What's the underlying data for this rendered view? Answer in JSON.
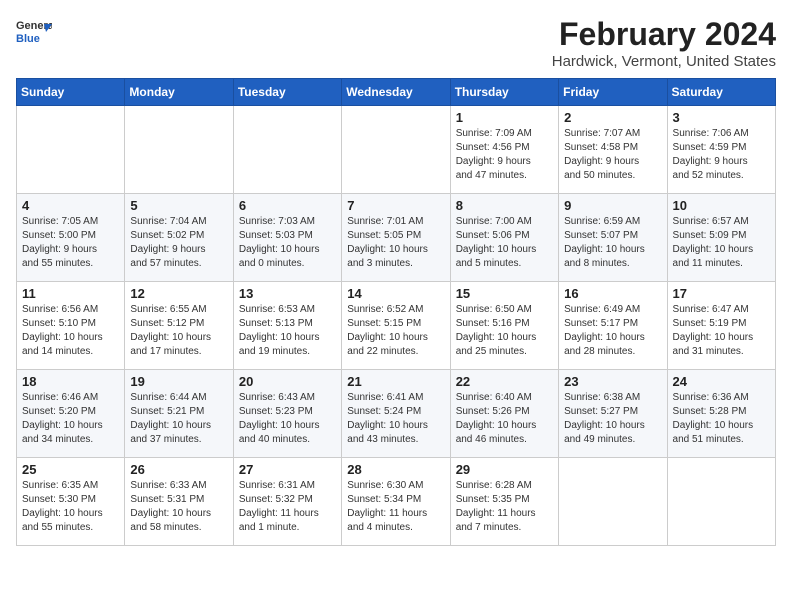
{
  "header": {
    "logo_line1": "General",
    "logo_line2": "Blue",
    "title": "February 2024",
    "subtitle": "Hardwick, Vermont, United States"
  },
  "days_of_week": [
    "Sunday",
    "Monday",
    "Tuesday",
    "Wednesday",
    "Thursday",
    "Friday",
    "Saturday"
  ],
  "weeks": [
    [
      {
        "day": "",
        "info": ""
      },
      {
        "day": "",
        "info": ""
      },
      {
        "day": "",
        "info": ""
      },
      {
        "day": "",
        "info": ""
      },
      {
        "day": "1",
        "info": "Sunrise: 7:09 AM\nSunset: 4:56 PM\nDaylight: 9 hours\nand 47 minutes."
      },
      {
        "day": "2",
        "info": "Sunrise: 7:07 AM\nSunset: 4:58 PM\nDaylight: 9 hours\nand 50 minutes."
      },
      {
        "day": "3",
        "info": "Sunrise: 7:06 AM\nSunset: 4:59 PM\nDaylight: 9 hours\nand 52 minutes."
      }
    ],
    [
      {
        "day": "4",
        "info": "Sunrise: 7:05 AM\nSunset: 5:00 PM\nDaylight: 9 hours\nand 55 minutes."
      },
      {
        "day": "5",
        "info": "Sunrise: 7:04 AM\nSunset: 5:02 PM\nDaylight: 9 hours\nand 57 minutes."
      },
      {
        "day": "6",
        "info": "Sunrise: 7:03 AM\nSunset: 5:03 PM\nDaylight: 10 hours\nand 0 minutes."
      },
      {
        "day": "7",
        "info": "Sunrise: 7:01 AM\nSunset: 5:05 PM\nDaylight: 10 hours\nand 3 minutes."
      },
      {
        "day": "8",
        "info": "Sunrise: 7:00 AM\nSunset: 5:06 PM\nDaylight: 10 hours\nand 5 minutes."
      },
      {
        "day": "9",
        "info": "Sunrise: 6:59 AM\nSunset: 5:07 PM\nDaylight: 10 hours\nand 8 minutes."
      },
      {
        "day": "10",
        "info": "Sunrise: 6:57 AM\nSunset: 5:09 PM\nDaylight: 10 hours\nand 11 minutes."
      }
    ],
    [
      {
        "day": "11",
        "info": "Sunrise: 6:56 AM\nSunset: 5:10 PM\nDaylight: 10 hours\nand 14 minutes."
      },
      {
        "day": "12",
        "info": "Sunrise: 6:55 AM\nSunset: 5:12 PM\nDaylight: 10 hours\nand 17 minutes."
      },
      {
        "day": "13",
        "info": "Sunrise: 6:53 AM\nSunset: 5:13 PM\nDaylight: 10 hours\nand 19 minutes."
      },
      {
        "day": "14",
        "info": "Sunrise: 6:52 AM\nSunset: 5:15 PM\nDaylight: 10 hours\nand 22 minutes."
      },
      {
        "day": "15",
        "info": "Sunrise: 6:50 AM\nSunset: 5:16 PM\nDaylight: 10 hours\nand 25 minutes."
      },
      {
        "day": "16",
        "info": "Sunrise: 6:49 AM\nSunset: 5:17 PM\nDaylight: 10 hours\nand 28 minutes."
      },
      {
        "day": "17",
        "info": "Sunrise: 6:47 AM\nSunset: 5:19 PM\nDaylight: 10 hours\nand 31 minutes."
      }
    ],
    [
      {
        "day": "18",
        "info": "Sunrise: 6:46 AM\nSunset: 5:20 PM\nDaylight: 10 hours\nand 34 minutes."
      },
      {
        "day": "19",
        "info": "Sunrise: 6:44 AM\nSunset: 5:21 PM\nDaylight: 10 hours\nand 37 minutes."
      },
      {
        "day": "20",
        "info": "Sunrise: 6:43 AM\nSunset: 5:23 PM\nDaylight: 10 hours\nand 40 minutes."
      },
      {
        "day": "21",
        "info": "Sunrise: 6:41 AM\nSunset: 5:24 PM\nDaylight: 10 hours\nand 43 minutes."
      },
      {
        "day": "22",
        "info": "Sunrise: 6:40 AM\nSunset: 5:26 PM\nDaylight: 10 hours\nand 46 minutes."
      },
      {
        "day": "23",
        "info": "Sunrise: 6:38 AM\nSunset: 5:27 PM\nDaylight: 10 hours\nand 49 minutes."
      },
      {
        "day": "24",
        "info": "Sunrise: 6:36 AM\nSunset: 5:28 PM\nDaylight: 10 hours\nand 51 minutes."
      }
    ],
    [
      {
        "day": "25",
        "info": "Sunrise: 6:35 AM\nSunset: 5:30 PM\nDaylight: 10 hours\nand 55 minutes."
      },
      {
        "day": "26",
        "info": "Sunrise: 6:33 AM\nSunset: 5:31 PM\nDaylight: 10 hours\nand 58 minutes."
      },
      {
        "day": "27",
        "info": "Sunrise: 6:31 AM\nSunset: 5:32 PM\nDaylight: 11 hours\nand 1 minute."
      },
      {
        "day": "28",
        "info": "Sunrise: 6:30 AM\nSunset: 5:34 PM\nDaylight: 11 hours\nand 4 minutes."
      },
      {
        "day": "29",
        "info": "Sunrise: 6:28 AM\nSunset: 5:35 PM\nDaylight: 11 hours\nand 7 minutes."
      },
      {
        "day": "",
        "info": ""
      },
      {
        "day": "",
        "info": ""
      }
    ]
  ]
}
